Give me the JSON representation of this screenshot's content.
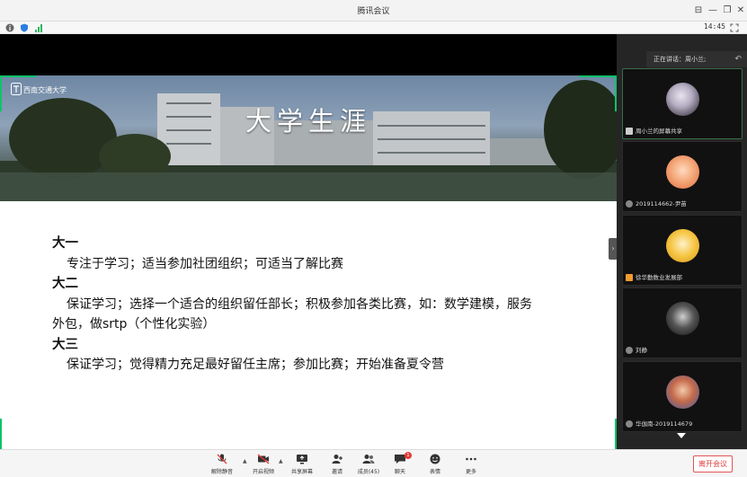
{
  "window": {
    "title": "腾讯会议"
  },
  "status": {
    "time": "14:45"
  },
  "slide": {
    "logo_text": "西南交通大学",
    "title": "大学生涯",
    "sections": [
      {
        "heading": "大一",
        "lines": [
          "专注于学习；适当参加社团组织；可适当了解比赛"
        ]
      },
      {
        "heading": "大二",
        "lines": [
          "保证学习；选择一个适合的组织留任部长；积极参加各类比赛，如：数学建模，服务",
          "外包，做srtp（个性化实验）"
        ]
      },
      {
        "heading": "大三",
        "lines": [
          "保证学习；觉得精力充足最好留任主席；参加比赛；开始准备夏令营"
        ]
      }
    ]
  },
  "side_panel": {
    "speaking_label": "正在讲话：周小兰;",
    "participants": [
      {
        "name": "周小兰的屏幕共享"
      },
      {
        "name": "2019114662-尹苗"
      },
      {
        "name": "徐华勤数业发展部"
      },
      {
        "name": "刘静"
      },
      {
        "name": "华伽南-2019114679"
      }
    ]
  },
  "toolbar": {
    "items": [
      {
        "label": "解除静音"
      },
      {
        "label": "开启视频"
      },
      {
        "label": "共享屏幕"
      },
      {
        "label": "邀请"
      },
      {
        "label": "成员(45)"
      },
      {
        "label": "聊天"
      },
      {
        "label": "表情"
      },
      {
        "label": "更多"
      }
    ],
    "chat_badge": "1",
    "leave_label": "离开会议"
  },
  "colors": {
    "accent_green": "#0ec36b",
    "leave_red": "#e03a3a"
  }
}
